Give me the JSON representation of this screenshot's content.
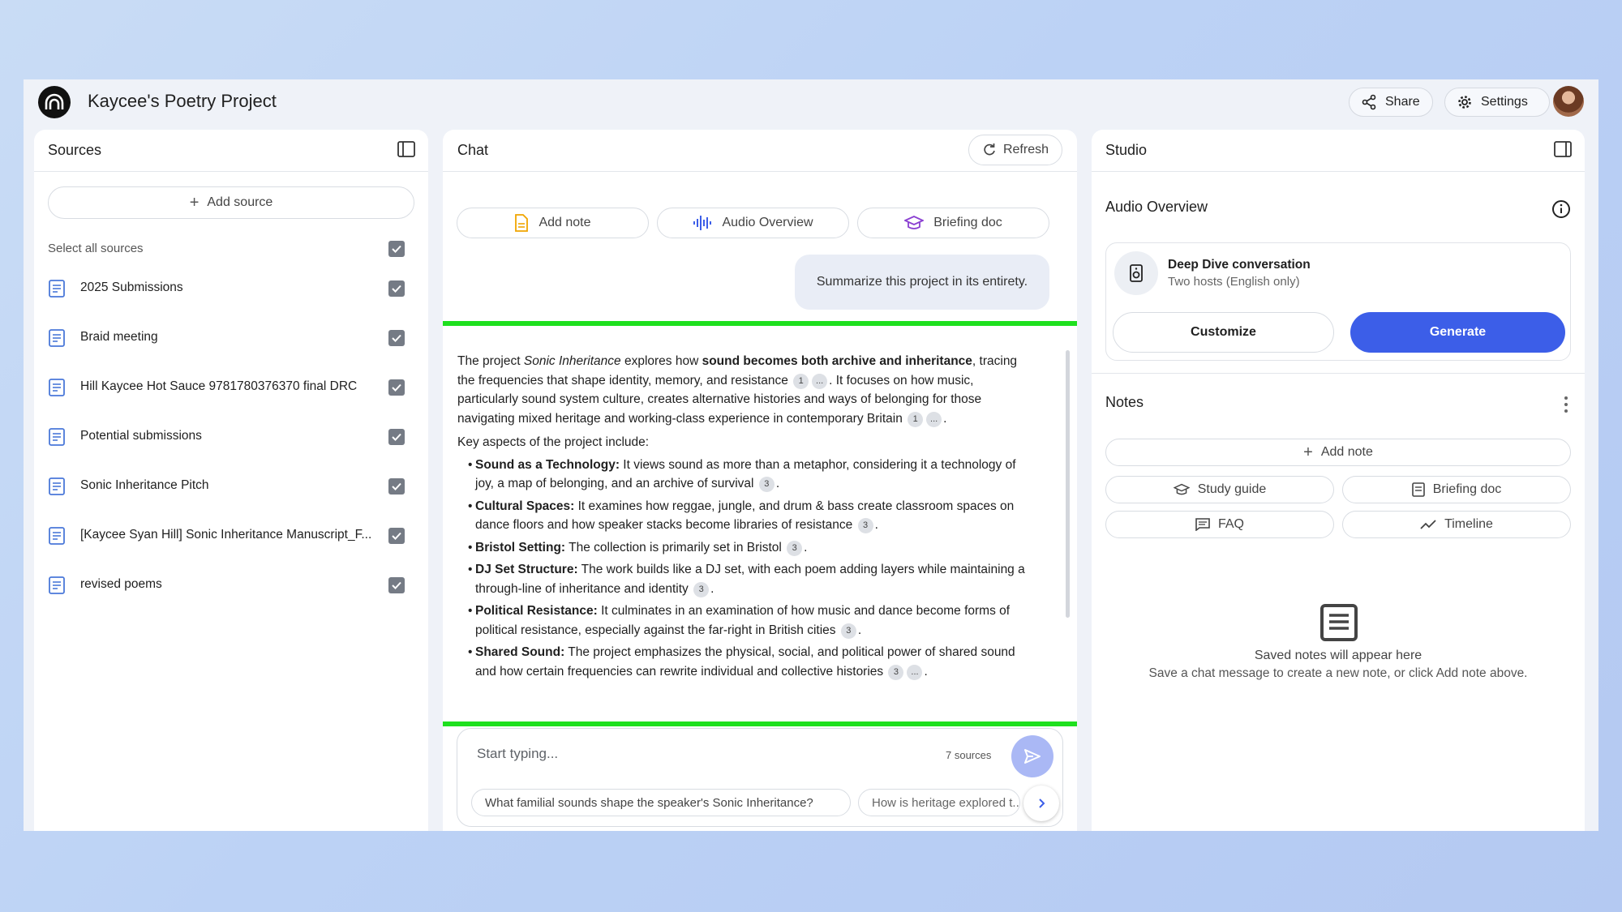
{
  "app": {
    "title": "Kaycee's Poetry Project",
    "share_label": "Share",
    "settings_label": "Settings"
  },
  "sources": {
    "title": "Sources",
    "add_source_label": "Add source",
    "select_all_label": "Select all sources",
    "items": [
      {
        "label": "2025 Submissions",
        "checked": true
      },
      {
        "label": "Braid meeting",
        "checked": true
      },
      {
        "label": "Hill Kaycee Hot Sauce 9781780376370 final DRC",
        "checked": true
      },
      {
        "label": "Potential submissions",
        "checked": true
      },
      {
        "label": "Sonic Inheritance Pitch",
        "checked": true
      },
      {
        "label": "[Kaycee Syan Hill] Sonic Inheritance Manuscript_F...",
        "checked": true
      },
      {
        "label": "revised poems",
        "checked": true
      }
    ]
  },
  "chat": {
    "title": "Chat",
    "refresh_label": "Refresh",
    "actions": {
      "add_note": "Add note",
      "audio_overview": "Audio Overview",
      "briefing_doc": "Briefing doc"
    },
    "user_message": "Summarize this project in its entirety.",
    "answer": {
      "intro": {
        "t1": "The project ",
        "em": "Sonic Inheritance",
        "t2": " explores how ",
        "strong": "sound becomes both archive and inheritance",
        "t3": ", tracing the frequencies that shape identity, memory, and resistance",
        "t4": ". It focuses on how music, particularly sound system culture, creates alternative histories and ways of belonging for those navigating mixed heritage and working-class experience in contemporary Britain",
        "t5": "."
      },
      "key_aspects": "Key aspects of the project include:",
      "bullets": [
        {
          "title": "Sound as a Technology:",
          "text": " It views sound as more than a metaphor, considering it a technology of joy, a map of belonging, and an archive of survival"
        },
        {
          "title": "Cultural Spaces:",
          "text": " It examines how reggae, jungle, and drum & bass create classroom spaces on dance floors and how speaker stacks become libraries of resistance"
        },
        {
          "title": "Bristol Setting:",
          "text": " The collection is primarily set in Bristol"
        },
        {
          "title": "DJ Set Structure:",
          "text": " The work builds like a DJ set, with each poem adding layers while maintaining a through-line of inheritance and identity"
        },
        {
          "title": "Political Resistance:",
          "text": " It culminates in an examination of how music and dance become forms of political resistance, especially against the far-right in British cities"
        },
        {
          "title": "Shared Sound:",
          "text": " The project emphasizes the physical, social, and political power of shared sound and how certain frequencies can rewrite individual and collective histories"
        }
      ],
      "cites": {
        "one": "1",
        "three": "3",
        "more": "..."
      }
    },
    "input": {
      "placeholder": "Start typing...",
      "sources_count": "7 sources"
    },
    "suggestions": [
      "What familial sounds shape the speaker's Sonic Inheritance?",
      "How is heritage explored t..."
    ]
  },
  "studio": {
    "title": "Studio",
    "audio_overview": {
      "title": "Audio Overview",
      "card_title": "Deep Dive conversation",
      "card_subtitle": "Two hosts (English only)",
      "customize_label": "Customize",
      "generate_label": "Generate"
    },
    "notes": {
      "title": "Notes",
      "add_note_label": "Add note",
      "study_guide_label": "Study guide",
      "briefing_doc_label": "Briefing doc",
      "faq_label": "FAQ",
      "timeline_label": "Timeline",
      "empty_title": "Saved notes will appear here",
      "empty_subtitle": "Save a chat message to create a new note, or click Add note above."
    }
  },
  "colors": {
    "accent": "#3c5ee8",
    "highlight": "#1ee01e",
    "send": "#aab8f5"
  }
}
